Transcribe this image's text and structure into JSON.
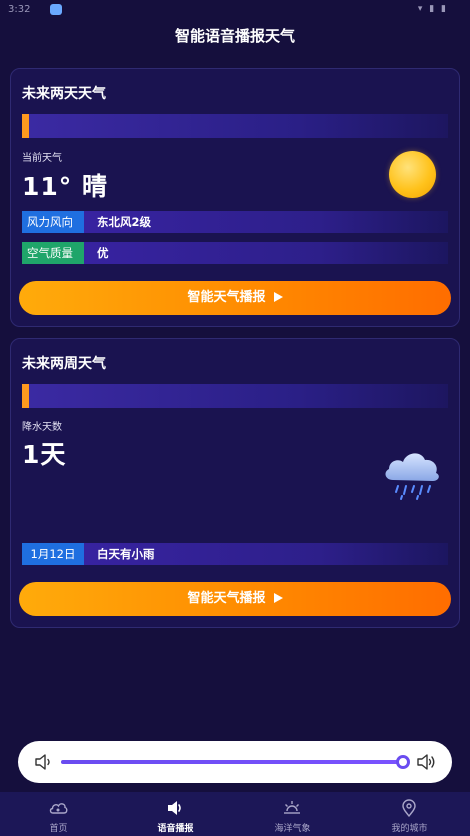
{
  "status_bar": {
    "time": "3:32",
    "right_icons": "▾ ▮ ▮"
  },
  "header": {
    "title": "智能语音播报天气"
  },
  "card_two_day": {
    "title": "未来两天天气",
    "current_label": "当前天气",
    "temperature": "11° 晴",
    "wind_tag": "风力风向",
    "wind_value": "东北风2级",
    "air_tag": "空气质量",
    "air_value": "优",
    "button_label": "智能天气播报"
  },
  "card_two_week": {
    "title": "未来两周天气",
    "rain_label": "降水天数",
    "rain_value": "1天",
    "date_tag": "1月12日",
    "date_value": "白天有小雨",
    "button_label": "智能天气播报"
  },
  "volume": {
    "level_percent": 100
  },
  "bottom_nav": {
    "items": [
      {
        "label": "首页",
        "icon": "cloud-icon"
      },
      {
        "label": "语音播报",
        "icon": "speaker-icon"
      },
      {
        "label": "海洋气象",
        "icon": "sun-horizon-icon"
      },
      {
        "label": "我的城市",
        "icon": "location-pin-icon"
      }
    ],
    "active_index": 1
  },
  "colors": {
    "background": "#150f3d",
    "card": "#1a1350",
    "accent_orange": "#ff9a1f",
    "tag_blue": "#1f6fe0",
    "tag_green": "#1fa56a",
    "slider": "#6a4cf0"
  }
}
